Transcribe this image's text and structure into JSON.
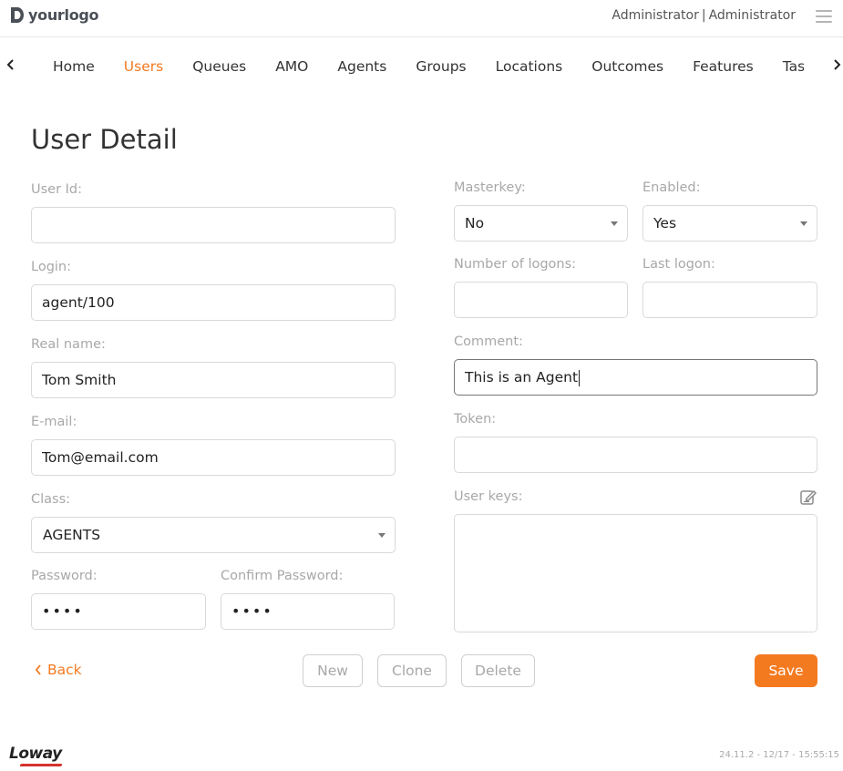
{
  "header": {
    "logo_text": "yourlogo",
    "user_first": "Administrator",
    "user_separator": "|",
    "user_second": "Administrator"
  },
  "nav": {
    "tabs": [
      {
        "label": "Home",
        "active": false
      },
      {
        "label": "Users",
        "active": true
      },
      {
        "label": "Queues",
        "active": false
      },
      {
        "label": "AMO",
        "active": false
      },
      {
        "label": "Agents",
        "active": false
      },
      {
        "label": "Groups",
        "active": false
      },
      {
        "label": "Locations",
        "active": false
      },
      {
        "label": "Outcomes",
        "active": false
      },
      {
        "label": "Features",
        "active": false
      },
      {
        "label": "Tasks",
        "active": false
      }
    ]
  },
  "page": {
    "title": "User Detail"
  },
  "form": {
    "user_id": {
      "label": "User Id:",
      "value": ""
    },
    "login": {
      "label": "Login:",
      "value": "agent/100"
    },
    "real_name": {
      "label": "Real name:",
      "value": "Tom Smith"
    },
    "email": {
      "label": "E-mail:",
      "value": "Tom@email.com"
    },
    "class": {
      "label": "Class:",
      "value": "AGENTS"
    },
    "password": {
      "label": "Password:",
      "value": "••••"
    },
    "confirm_password": {
      "label": "Confirm Password:",
      "value": "••••"
    },
    "masterkey": {
      "label": "Masterkey:",
      "value": "No"
    },
    "enabled": {
      "label": "Enabled:",
      "value": "Yes"
    },
    "num_logons": {
      "label": "Number of logons:",
      "value": ""
    },
    "last_logon": {
      "label": "Last logon:",
      "value": ""
    },
    "comment": {
      "label": "Comment:",
      "value": "This is an Agent"
    },
    "token": {
      "label": "Token:",
      "value": ""
    },
    "user_keys": {
      "label": "User keys:",
      "value": ""
    }
  },
  "actions": {
    "back_label": "Back",
    "new_label": "New",
    "clone_label": "Clone",
    "delete_label": "Delete",
    "save_label": "Save"
  },
  "footer": {
    "brand": "Loway",
    "version": "24.11.2 - 12/17 - 15:55:15"
  },
  "colors": {
    "accent": "#f47a20",
    "muted_label": "#a8a8a8",
    "border": "#d9d9d9"
  }
}
